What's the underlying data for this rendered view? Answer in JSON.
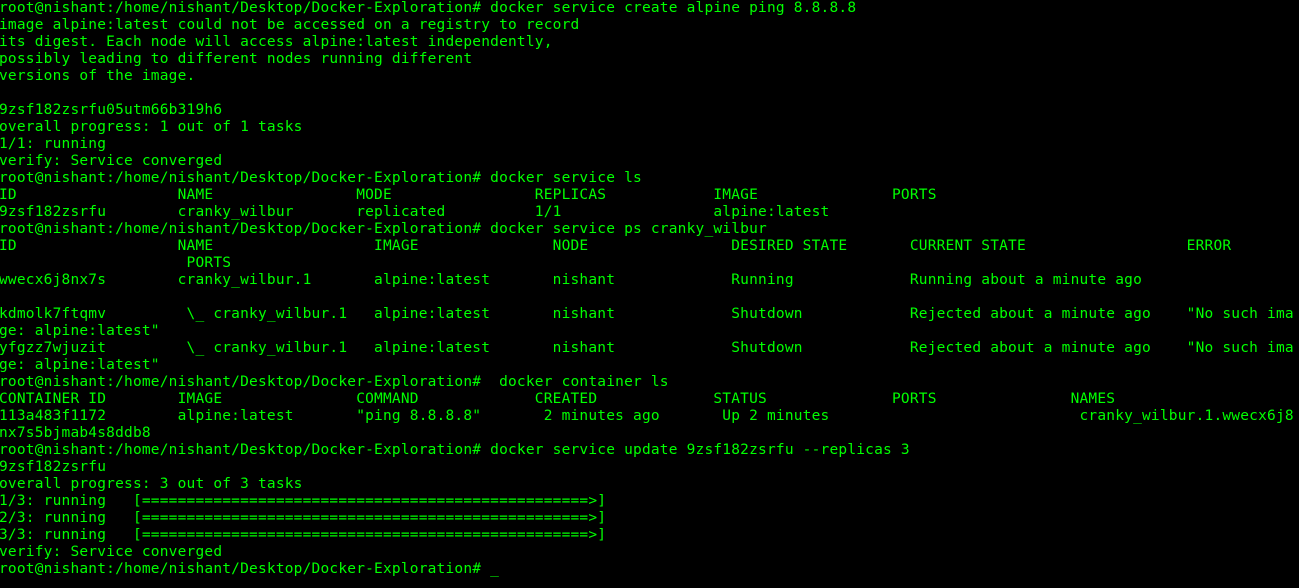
{
  "terminal": {
    "text_color": "#00ff00",
    "background_color": "#000000",
    "lines": [
      "root@nishant:/home/nishant/Desktop/Docker-Exploration# docker service create alpine ping 8.8.8.8",
      "image alpine:latest could not be accessed on a registry to record",
      "its digest. Each node will access alpine:latest independently,",
      "possibly leading to different nodes running different",
      "versions of the image.",
      "",
      "9zsf182zsrfu05utm66b319h6",
      "overall progress: 1 out of 1 tasks",
      "1/1: running",
      "verify: Service converged",
      "root@nishant:/home/nishant/Desktop/Docker-Exploration# docker service ls",
      "ID                  NAME                MODE                REPLICAS            IMAGE               PORTS",
      "9zsf182zsrfu        cranky_wilbur       replicated          1/1                 alpine:latest",
      "root@nishant:/home/nishant/Desktop/Docker-Exploration# docker service ps cranky_wilbur",
      "ID                  NAME                  IMAGE               NODE                DESIRED STATE       CURRENT STATE                  ERROR",
      "                     PORTS",
      "wwecx6j8nx7s        cranky_wilbur.1       alpine:latest       nishant             Running             Running about a minute ago",
      "",
      "kdmolk7ftqmv         \\_ cranky_wilbur.1   alpine:latest       nishant             Shutdown            Rejected about a minute ago    \"No such ima",
      "ge: alpine:latest\"",
      "yfgzz7wjuzit         \\_ cranky_wilbur.1   alpine:latest       nishant             Shutdown            Rejected about a minute ago    \"No such ima",
      "ge: alpine:latest\"",
      "root@nishant:/home/nishant/Desktop/Docker-Exploration#  docker container ls",
      "CONTAINER ID        IMAGE               COMMAND             CREATED             STATUS              PORTS               NAMES",
      "113a483f1172        alpine:latest       \"ping 8.8.8.8\"       2 minutes ago       Up 2 minutes                            cranky_wilbur.1.wwecx6j8",
      "nx7s5bjmab4s8ddb8",
      "root@nishant:/home/nishant/Desktop/Docker-Exploration# docker service update 9zsf182zsrfu --replicas 3",
      "9zsf182zsrfu",
      "overall progress: 3 out of 3 tasks",
      "1/3: running   [==================================================>]",
      "2/3: running   [==================================================>]",
      "3/3: running   [==================================================>]",
      "verify: Service converged",
      "root@nishant:/home/nishant/Desktop/Docker-Exploration# _"
    ]
  }
}
